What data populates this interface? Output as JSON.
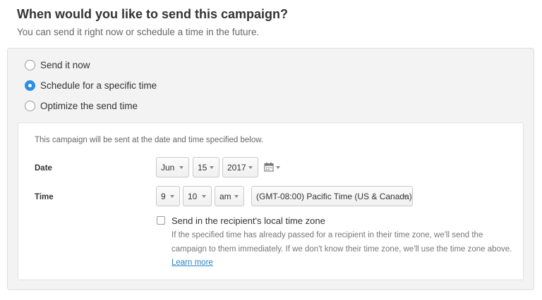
{
  "heading": {
    "title": "When would you like to send this campaign?",
    "subtitle": "You can send it right now or schedule a time in the future."
  },
  "options": [
    {
      "label": "Send it now",
      "selected": false
    },
    {
      "label": "Schedule for a specific time",
      "selected": true
    },
    {
      "label": "Optimize the send time",
      "selected": false
    }
  ],
  "schedule": {
    "description": "This campaign will be sent at the date and time specified below.",
    "date_label": "Date",
    "time_label": "Time",
    "month": "Jun",
    "day": "15",
    "year": "2017",
    "hour": "9",
    "minute": "10",
    "ampm": "am",
    "timezone": "(GMT-08:00) Pacific Time (US & Canada)"
  },
  "local_tz": {
    "label": "Send in the recipient's local time zone",
    "checked": false,
    "help_line1": "If the specified time has already passed for a recipient in their time zone, we'll send the",
    "help_line2": "campaign to them immediately. If we don't know their time zone, we'll use the time zone above.",
    "learn_more": "Learn more"
  },
  "colors": {
    "accent": "#2d8ee8",
    "link": "#2b84c6"
  }
}
